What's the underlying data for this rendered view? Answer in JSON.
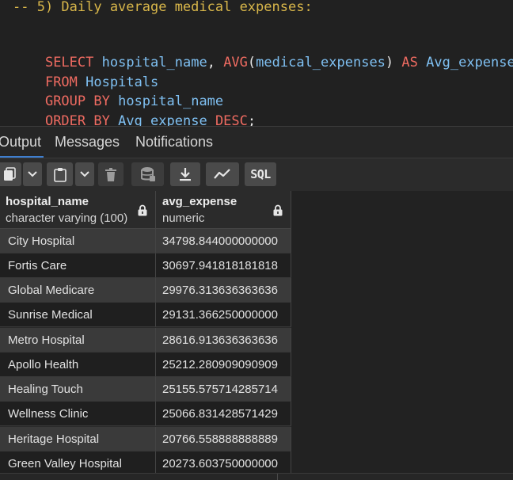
{
  "editor": {
    "comment": "-- 5) Daily average medical expenses:",
    "line1": {
      "kw_select": "SELECT",
      "col1": "hospital_name",
      "comma": ",",
      "fn_avg": "AVG",
      "paren_open": "(",
      "col2": "medical_expenses",
      "paren_close": ")",
      "kw_as": "AS",
      "alias": "Avg_expense"
    },
    "line2": {
      "kw_from": "FROM",
      "table": "Hospitals"
    },
    "line3": {
      "kw_group_by": "GROUP BY",
      "col": "hospital_name"
    },
    "line4": {
      "kw_order_by": "ORDER BY",
      "col": "Avg_expense",
      "kw_desc": "DESC",
      "semicolon": ";"
    }
  },
  "tabs": [
    {
      "label": "Output",
      "active": true
    },
    {
      "label": "Messages",
      "active": false
    },
    {
      "label": "Notifications",
      "active": false
    }
  ],
  "toolbar": {
    "icons": [
      "copy-icon",
      "dropdown-icon",
      "paste-icon",
      "dropdown-icon",
      "delete-icon",
      "save-data-icon",
      "download-icon",
      "graph-visualiser-icon"
    ],
    "sql_label": "SQL"
  },
  "grid": {
    "columns": [
      {
        "name": "hospital_name",
        "type": "character varying (100)",
        "locked": true
      },
      {
        "name": "avg_expense",
        "type": "numeric",
        "locked": true
      }
    ],
    "rows": [
      [
        "City Hospital",
        "34798.844000000000"
      ],
      [
        "Fortis Care",
        "30697.941818181818"
      ],
      [
        "Global Medicare",
        "29976.313636363636"
      ],
      [
        "Sunrise Medical",
        "29131.366250000000"
      ],
      [
        "Metro Hospital",
        "28616.913636363636"
      ],
      [
        "Apollo Health",
        "25212.280909090909"
      ],
      [
        "Healing Touch",
        "25155.575714285714"
      ],
      [
        "Wellness Clinic",
        "25066.831428571429"
      ],
      [
        "Heritage Hospital",
        "20766.558888888889"
      ],
      [
        "Green Valley Hospital",
        "20273.603750000000"
      ]
    ]
  },
  "colors": {
    "keyword": "#ef6b61",
    "identifier": "#7fc0f2",
    "comment": "#d9b74a",
    "active_tab": "#3f7fcf"
  }
}
